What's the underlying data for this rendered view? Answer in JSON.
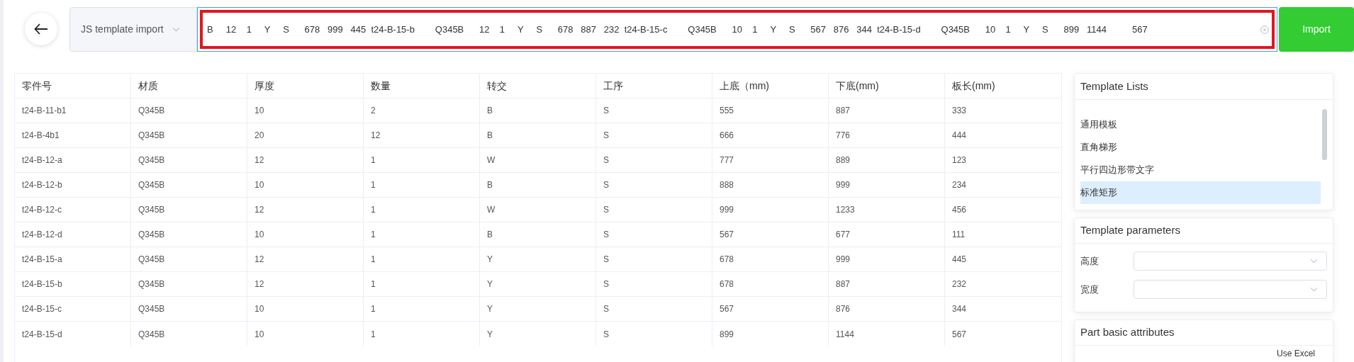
{
  "toolbar": {
    "template_select": "JS template import",
    "input_value": "B     12    1     Y     S      678   999   445  t24-B-15-b        Q345B      12    1     Y     S      678   887   232  t24-B-15-c        Q345B      10    1     Y     S      567   876   344  t24-B-15-d        Q345B      10    1     Y     S      899   1144          567",
    "import_button": "Import"
  },
  "table": {
    "columns": [
      "零件号",
      "材质",
      "厚度",
      "数量",
      "转交",
      "工序",
      "上底（mm)",
      "下底(mm)",
      "板长(mm)"
    ],
    "rows": [
      [
        "t24-B-11-b1",
        "Q345B",
        "10",
        "2",
        "B",
        "S",
        "555",
        "887",
        "333"
      ],
      [
        "t24-B-4b1",
        "Q345B",
        "20",
        "12",
        "B",
        "S",
        "666",
        "776",
        "444"
      ],
      [
        "t24-B-12-a",
        "Q345B",
        "12",
        "1",
        "W",
        "S",
        "777",
        "889",
        "123"
      ],
      [
        "t24-B-12-b",
        "Q345B",
        "10",
        "1",
        "B",
        "S",
        "888",
        "999",
        "234"
      ],
      [
        "t24-B-12-c",
        "Q345B",
        "12",
        "1",
        "W",
        "S",
        "999",
        "1233",
        "456"
      ],
      [
        "t24-B-12-d",
        "Q345B",
        "10",
        "1",
        "B",
        "S",
        "567",
        "677",
        "111"
      ],
      [
        "t24-B-15-a",
        "Q345B",
        "12",
        "1",
        "Y",
        "S",
        "678",
        "999",
        "445"
      ],
      [
        "t24-B-15-b",
        "Q345B",
        "12",
        "1",
        "Y",
        "S",
        "678",
        "887",
        "232"
      ],
      [
        "t24-B-15-c",
        "Q345B",
        "10",
        "1",
        "Y",
        "S",
        "567",
        "876",
        "344"
      ],
      [
        "t24-B-15-d",
        "Q345B",
        "10",
        "1",
        "Y",
        "S",
        "899",
        "1144",
        "567"
      ]
    ]
  },
  "template_lists": {
    "title": "Template Lists",
    "items": [
      {
        "label": "通用模板",
        "selected": false
      },
      {
        "label": "直角梯形",
        "selected": false
      },
      {
        "label": "平行四边形带文字",
        "selected": false
      },
      {
        "label": "标准矩形",
        "selected": true
      }
    ]
  },
  "template_parameters": {
    "title": "Template parameters",
    "fields": [
      {
        "label": "高度"
      },
      {
        "label": "宽度"
      }
    ]
  },
  "part_basic_attributes": {
    "title": "Part basic attributes",
    "link": "Use Excel"
  }
}
